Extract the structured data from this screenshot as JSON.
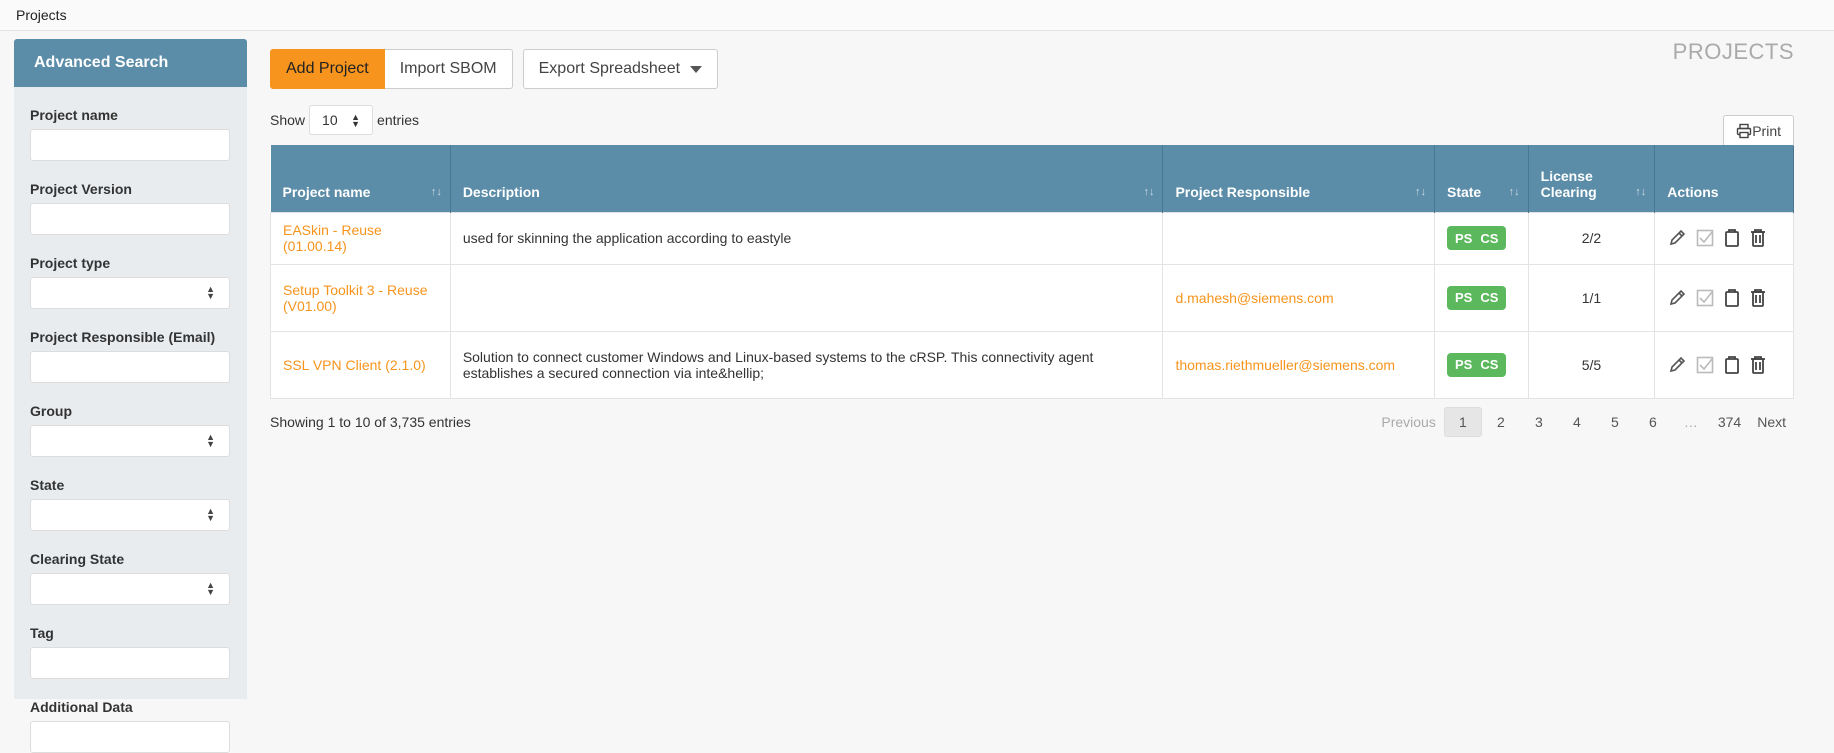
{
  "topbar": {
    "title": "Projects"
  },
  "sidebar": {
    "header": "Advanced Search",
    "fields": [
      {
        "label": "Project name",
        "type": "text"
      },
      {
        "label": "Project Version",
        "type": "text"
      },
      {
        "label": "Project type",
        "type": "select"
      },
      {
        "label": "Project Responsible (Email)",
        "type": "text"
      },
      {
        "label": "Group",
        "type": "select"
      },
      {
        "label": "State",
        "type": "select"
      },
      {
        "label": "Clearing State",
        "type": "select"
      },
      {
        "label": "Tag",
        "type": "text"
      },
      {
        "label": "Additional Data",
        "type": "text"
      }
    ]
  },
  "toolbar": {
    "add_project": "Add Project",
    "import_sbom": "Import SBOM",
    "export_spreadsheet": "Export Spreadsheet"
  },
  "page_heading": "PROJECTS",
  "length": {
    "show": "Show",
    "value": "10",
    "entries": "entries"
  },
  "print": "Print",
  "table": {
    "headers": [
      "Project name",
      "Description",
      "Project Responsible",
      "State",
      "License Clearing",
      "Actions"
    ],
    "rows": [
      {
        "name": "EASkin - Reuse (01.00.14)",
        "description": "used for skinning the application according to eastyle",
        "responsible": "",
        "state": [
          "PS",
          "CS"
        ],
        "clearing": "2/2"
      },
      {
        "name": "Setup Toolkit 3 - Reuse (V01.00)",
        "description": "",
        "responsible": "d.mahesh@siemens.com",
        "state": [
          "PS",
          "CS"
        ],
        "clearing": "1/1"
      },
      {
        "name": "SSL VPN Client (2.1.0)",
        "description": "Solution to connect customer Windows and Linux-based systems to the cRSP. This connectivity agent establishes a secured connection via inte&hellip;",
        "responsible": "thomas.riethmueller@siemens.com",
        "state": [
          "PS",
          "CS"
        ],
        "clearing": "5/5"
      }
    ]
  },
  "info": "Showing 1 to 10 of 3,735 entries",
  "pagination": {
    "previous": "Previous",
    "pages": [
      "1",
      "2",
      "3",
      "4",
      "5",
      "6",
      "…",
      "374"
    ],
    "next": "Next"
  },
  "colors": {
    "accent": "#f7941d",
    "header": "#5b8ca8",
    "badge": "#5cb85c"
  }
}
